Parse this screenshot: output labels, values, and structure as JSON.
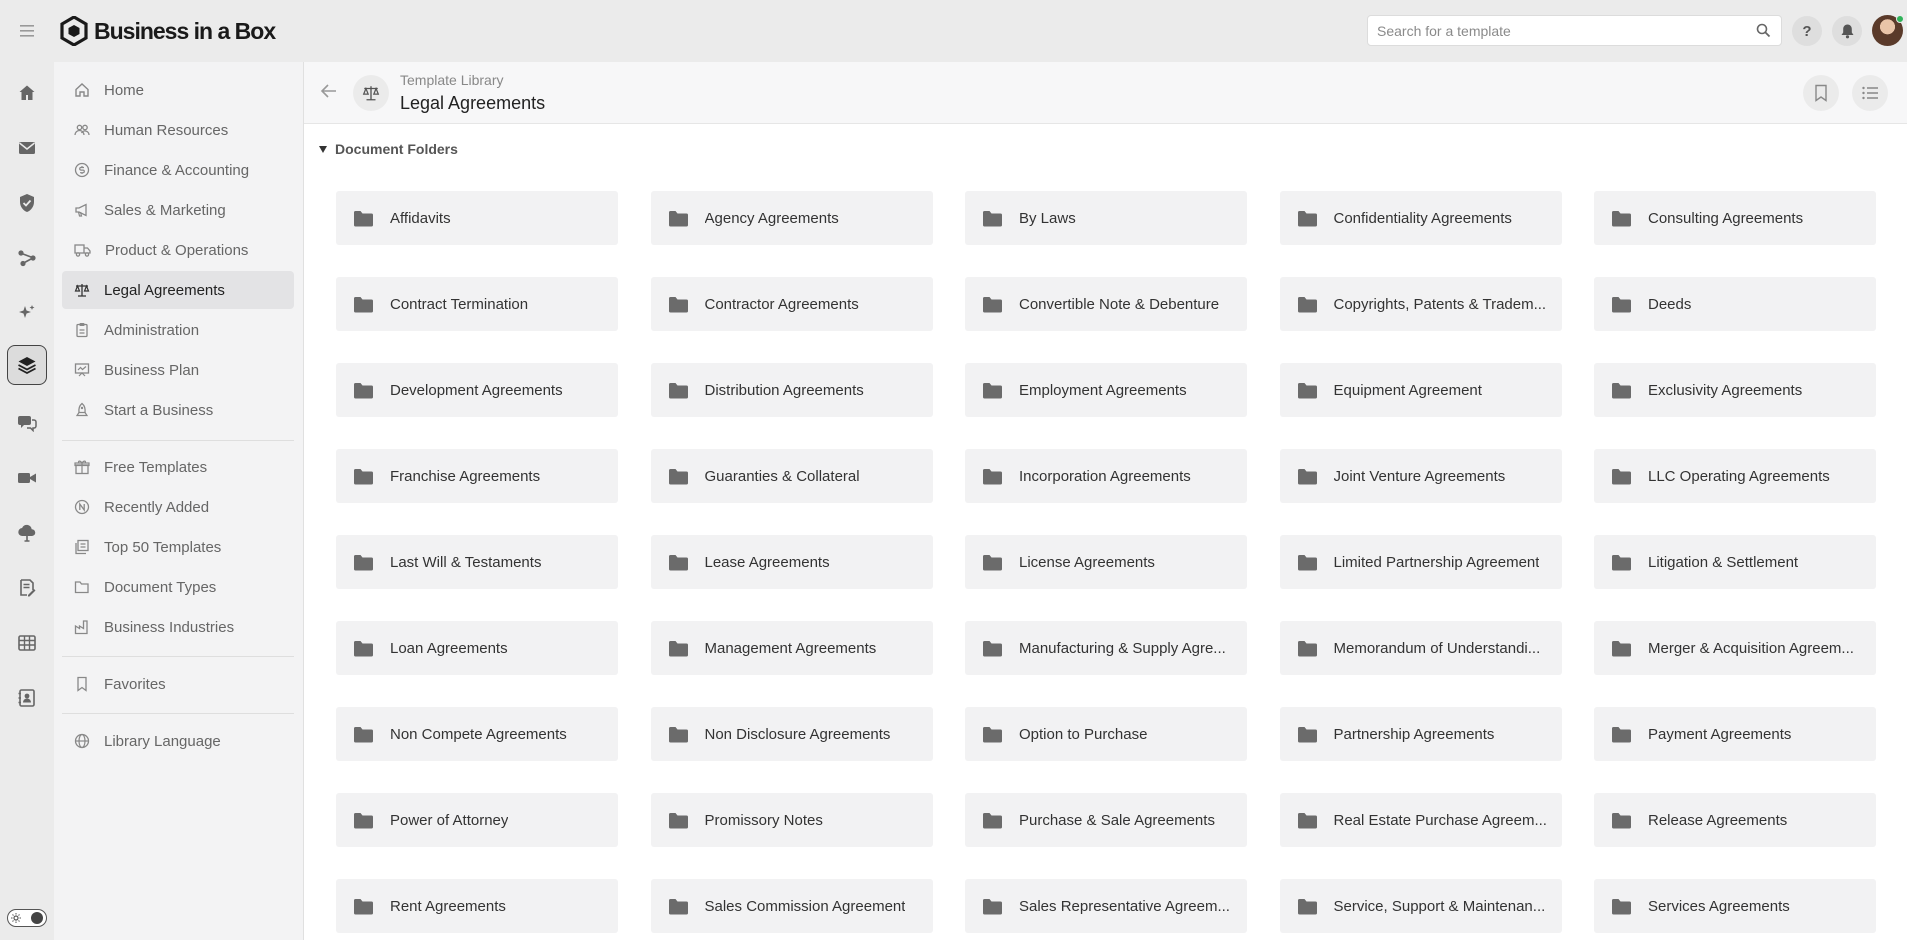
{
  "app": {
    "logo_text": "Business in a Box"
  },
  "search": {
    "placeholder": "Search for a template"
  },
  "topbar": {
    "help_label": "?"
  },
  "rail": {
    "items": [
      {
        "icon": "home-icon"
      },
      {
        "icon": "mail-icon"
      },
      {
        "icon": "shield-check-icon"
      },
      {
        "icon": "workflow-icon"
      },
      {
        "icon": "sparkle-icon"
      },
      {
        "icon": "layers-icon",
        "active": true
      },
      {
        "icon": "chat-icon"
      },
      {
        "icon": "video-icon"
      },
      {
        "icon": "cloud-icon"
      },
      {
        "icon": "signature-icon"
      },
      {
        "icon": "spreadsheet-icon"
      },
      {
        "icon": "contacts-icon"
      }
    ]
  },
  "nav": {
    "items": [
      {
        "label": "Home",
        "icon": "home-icon"
      },
      {
        "label": "Human Resources",
        "icon": "people-icon"
      },
      {
        "label": "Finance & Accounting",
        "icon": "dollar-icon"
      },
      {
        "label": "Sales & Marketing",
        "icon": "megaphone-icon"
      },
      {
        "label": "Product & Operations",
        "icon": "truck-icon"
      },
      {
        "label": "Legal Agreements",
        "icon": "scale-icon",
        "active": true
      },
      {
        "label": "Administration",
        "icon": "clipboard-icon"
      },
      {
        "label": "Business Plan",
        "icon": "presentation-icon"
      },
      {
        "label": "Start a Business",
        "icon": "rocket-icon"
      },
      {
        "label": "Free Templates",
        "icon": "gift-icon"
      },
      {
        "label": "Recently Added",
        "icon": "new-badge-icon"
      },
      {
        "label": "Top 50 Templates",
        "icon": "stack-icon"
      },
      {
        "label": "Document Types",
        "icon": "folder-open-icon"
      },
      {
        "label": "Business Industries",
        "icon": "factory-icon"
      },
      {
        "label": "Favorites",
        "icon": "bookmark-icon"
      },
      {
        "label": "Library Language",
        "icon": "globe-icon"
      }
    ]
  },
  "header": {
    "breadcrumb": "Template Library",
    "title": "Legal Agreements"
  },
  "section": {
    "label": "Document Folders"
  },
  "folders": [
    "Affidavits",
    "Agency Agreements",
    "By Laws",
    "Confidentiality Agreements",
    "Consulting Agreements",
    "Contract Termination",
    "Contractor Agreements",
    "Convertible Note & Debenture",
    "Copyrights, Patents & Tradem...",
    "Deeds",
    "Development Agreements",
    "Distribution Agreements",
    "Employment Agreements",
    "Equipment Agreement",
    "Exclusivity Agreements",
    "Franchise Agreements",
    "Guaranties & Collateral",
    "Incorporation Agreements",
    "Joint Venture Agreements",
    "LLC Operating Agreements",
    "Last Will & Testaments",
    "Lease Agreements",
    "License Agreements",
    "Limited Partnership Agreement",
    "Litigation & Settlement",
    "Loan Agreements",
    "Management Agreements",
    "Manufacturing & Supply Agre...",
    "Memorandum of Understandi...",
    "Merger & Acquisition Agreem...",
    "Non Compete Agreements",
    "Non Disclosure Agreements",
    "Option to Purchase",
    "Partnership Agreements",
    "Payment Agreements",
    "Power of Attorney",
    "Promissory Notes",
    "Purchase & Sale Agreements",
    "Real Estate Purchase Agreem...",
    "Release Agreements",
    "Rent Agreements",
    "Sales Commission Agreement",
    "Sales Representative Agreem...",
    "Service, Support & Maintenan...",
    "Services Agreements"
  ],
  "colors": {
    "topbar_bg": "#ebebeb",
    "nav_bg": "#f3f3f4",
    "folder_bg": "#f2f2f3",
    "folder_icon": "#6b6b6b",
    "active_bg": "#e3e3e5",
    "status_online": "#2fb35a"
  }
}
